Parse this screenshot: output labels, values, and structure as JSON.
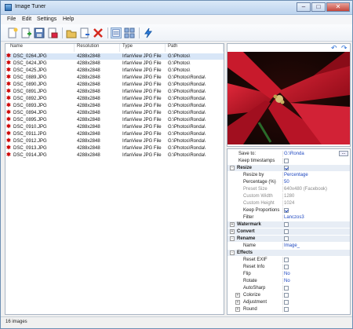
{
  "window": {
    "title": "Image Tuner",
    "controls": {
      "minimize": "–",
      "maximize": "□",
      "close": "✕"
    }
  },
  "menu": [
    "File",
    "Edit",
    "Settings",
    "Help"
  ],
  "toolbar_icons": [
    "new-list-icon",
    "add-files-icon",
    "save-icon",
    "print-icon",
    "add-folder-icon",
    "remove-icon",
    "delete-icon",
    "details-view-icon",
    "thumbnails-view-icon",
    "process-icon"
  ],
  "table": {
    "headers": [
      "Name",
      "Resolution",
      "Type",
      "Path"
    ],
    "rows": [
      {
        "name": "DSC_0264.JPG",
        "res": "4288x2848",
        "type": "IrfanView JPG File",
        "path": "G:\\Photos\\"
      },
      {
        "name": "DSC_0424.JPG",
        "res": "4288x2848",
        "type": "IrfanView JPG File",
        "path": "G:\\Photos\\"
      },
      {
        "name": "DSC_0425.JPG",
        "res": "4288x2848",
        "type": "IrfanView JPG File",
        "path": "G:\\Photos\\"
      },
      {
        "name": "DSC_0889.JPG",
        "res": "4288x2848",
        "type": "IrfanView JPG File",
        "path": "G:\\Photos\\Ronda\\"
      },
      {
        "name": "DSC_0890.JPG",
        "res": "4288x2848",
        "type": "IrfanView JPG File",
        "path": "G:\\Photos\\Ronda\\"
      },
      {
        "name": "DSC_0891.JPG",
        "res": "4288x2848",
        "type": "IrfanView JPG File",
        "path": "G:\\Photos\\Ronda\\"
      },
      {
        "name": "DSC_0892.JPG",
        "res": "4288x2848",
        "type": "IrfanView JPG File",
        "path": "G:\\Photos\\Ronda\\"
      },
      {
        "name": "DSC_0893.JPG",
        "res": "4288x2848",
        "type": "IrfanView JPG File",
        "path": "G:\\Photos\\Ronda\\"
      },
      {
        "name": "DSC_0894.JPG",
        "res": "4288x2848",
        "type": "IrfanView JPG File",
        "path": "G:\\Photos\\Ronda\\"
      },
      {
        "name": "DSC_0895.JPG",
        "res": "4288x2848",
        "type": "IrfanView JPG File",
        "path": "G:\\Photos\\Ronda\\"
      },
      {
        "name": "DSC_0910.JPG",
        "res": "4288x2848",
        "type": "IrfanView JPG File",
        "path": "G:\\Photos\\Ronda\\"
      },
      {
        "name": "DSC_0911.JPG",
        "res": "4288x2848",
        "type": "IrfanView JPG File",
        "path": "G:\\Photos\\Ronda\\"
      },
      {
        "name": "DSC_0912.JPG",
        "res": "4288x2848",
        "type": "IrfanView JPG File",
        "path": "G:\\Photos\\Ronda\\"
      },
      {
        "name": "DSC_0913.JPG",
        "res": "4288x2848",
        "type": "IrfanView JPG File",
        "path": "G:\\Photos\\Ronda\\"
      },
      {
        "name": "DSC_0914.JPG",
        "res": "4288x2848",
        "type": "IrfanView JPG File",
        "path": "G:\\Photos\\Ronda\\"
      }
    ],
    "selected_index": 0
  },
  "preview": {
    "undo": "↶",
    "redo": "↷"
  },
  "properties": {
    "save_to": {
      "label": "Save to:",
      "value": "G:\\Ronda",
      "browse": "..."
    },
    "keep_timestamps": {
      "label": "Keep timestamps",
      "checked": false
    },
    "resize": {
      "label": "Resize",
      "checked": true
    },
    "resize_by": {
      "label": "Resize by",
      "value": "Percentage"
    },
    "percentage": {
      "label": "Percentage (%)",
      "value": "50"
    },
    "preset_size": {
      "label": "Preset Size",
      "value": "640x480 (Facebook)"
    },
    "custom_width": {
      "label": "Custom Width",
      "value": "1280"
    },
    "custom_height": {
      "label": "Custom Height",
      "value": "1024"
    },
    "keep_proportions": {
      "label": "Keep Proportions",
      "checked": true
    },
    "filter": {
      "label": "Filter",
      "value": "Lanczos3"
    },
    "watermark": {
      "label": "Watermark",
      "checked": false
    },
    "convert": {
      "label": "Convert",
      "checked": false
    },
    "rename": {
      "label": "Rename",
      "checked": false
    },
    "name": {
      "label": "Name",
      "value": "Image_"
    },
    "effects": {
      "label": "Effects"
    },
    "reset_exif": {
      "label": "Reset EXIF",
      "checked": false
    },
    "reset_info": {
      "label": "Reset Info",
      "checked": false
    },
    "flip": {
      "label": "Flip",
      "value": "No"
    },
    "rotate": {
      "label": "Rotate",
      "value": "No"
    },
    "autosharp": {
      "label": "AutoSharp",
      "checked": false
    },
    "colorize": {
      "label": "Colorize",
      "checked": false
    },
    "adjustment": {
      "label": "Adjustment",
      "checked": false
    },
    "round": {
      "label": "Round",
      "checked": false
    }
  },
  "status": {
    "text": "16 images"
  }
}
